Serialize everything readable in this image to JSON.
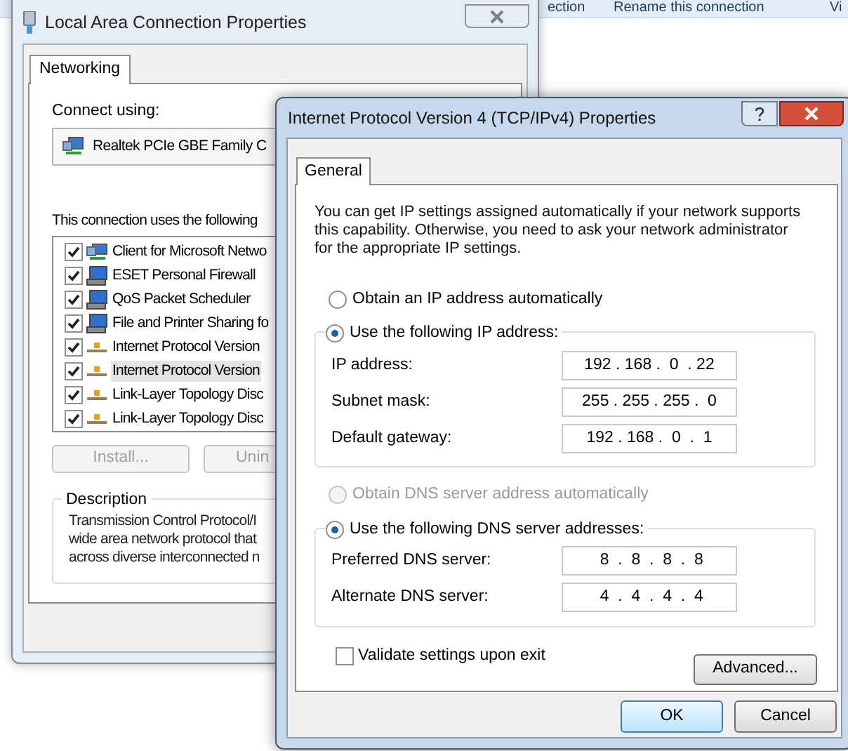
{
  "background_toolbar": {
    "items": [
      "ection",
      "Rename this connection",
      "Vi"
    ]
  },
  "back_window": {
    "title": "Local Area Connection Properties",
    "tabs": [
      {
        "label": "Networking",
        "selected": true
      }
    ],
    "connect_using_label": "Connect using:",
    "adapter": "Realtek PCIe GBE Family C",
    "components_label": "This connection uses the following",
    "components": [
      {
        "label": "Client for Microsoft Netwo",
        "kind": "client",
        "checked": true,
        "selected": false
      },
      {
        "label": "ESET Personal Firewall",
        "kind": "service",
        "checked": true,
        "selected": false
      },
      {
        "label": "QoS Packet Scheduler",
        "kind": "service",
        "checked": true,
        "selected": false
      },
      {
        "label": "File and Printer Sharing fo",
        "kind": "service",
        "checked": true,
        "selected": false
      },
      {
        "label": "Internet Protocol Version",
        "kind": "protocol",
        "checked": true,
        "selected": false
      },
      {
        "label": "Internet Protocol Version",
        "kind": "protocol",
        "checked": true,
        "selected": true
      },
      {
        "label": "Link-Layer Topology Disc",
        "kind": "protocol",
        "checked": true,
        "selected": false
      },
      {
        "label": "Link-Layer Topology Disc",
        "kind": "protocol",
        "checked": true,
        "selected": false
      }
    ],
    "buttons": [
      {
        "label": "Install...",
        "disabled": true
      },
      {
        "label": "Unin",
        "disabled": true
      }
    ],
    "description": {
      "title": "Description",
      "lines": [
        "Transmission Control Protocol/I",
        "wide area network protocol that",
        "across diverse interconnected n"
      ]
    }
  },
  "front_window": {
    "title": "Internet Protocol Version 4 (TCP/IPv4) Properties",
    "tabs": [
      {
        "label": "General",
        "selected": true
      }
    ],
    "intro": "You can get IP settings assigned automatically if your network supports this capability. Otherwise, you need to ask your network administrator for the appropriate IP settings.",
    "ip_mode": [
      {
        "label": "Obtain an IP address automatically",
        "selected": false,
        "disabled": false
      },
      {
        "label": "Use the following IP address:",
        "selected": true,
        "disabled": false
      }
    ],
    "ip_fields": [
      {
        "label": "IP address:",
        "value": "192 . 168 .  0  . 22"
      },
      {
        "label": "Subnet mask:",
        "value": "255 . 255 . 255 .  0"
      },
      {
        "label": "Default gateway:",
        "value": "192 . 168 .  0  .  1"
      }
    ],
    "dns_mode": [
      {
        "label": "Obtain DNS server address automatically",
        "selected": false,
        "disabled": true
      },
      {
        "label": "Use the following DNS server addresses:",
        "selected": true,
        "disabled": false
      }
    ],
    "dns_fields": [
      {
        "label": "Preferred DNS server:",
        "value": " 8  .  8  .  8  .  8"
      },
      {
        "label": "Alternate DNS server:",
        "value": " 4  .  4  .  4  .  4"
      }
    ],
    "validate": {
      "label": "Validate settings upon exit",
      "checked": false
    },
    "advanced_button": "Advanced...",
    "buttons": [
      {
        "label": "OK",
        "default": true
      },
      {
        "label": "Cancel",
        "default": false
      }
    ]
  }
}
